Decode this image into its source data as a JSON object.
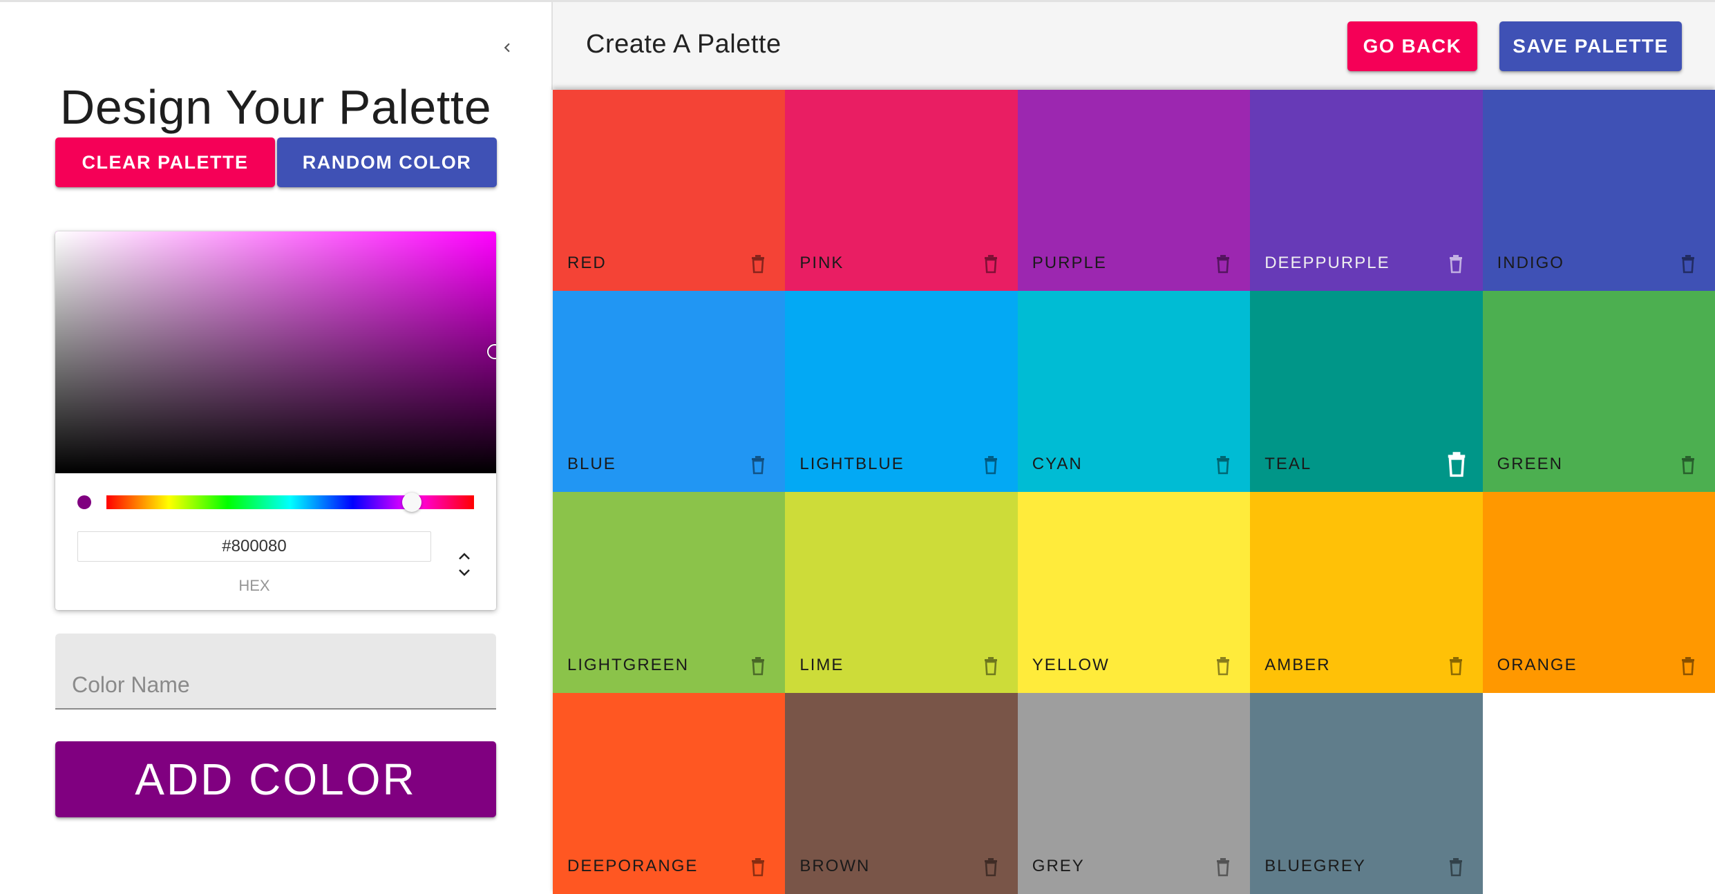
{
  "sidebar": {
    "title": "Design Your Palette",
    "clear_label": "Clear Palette",
    "random_label": "Random Color",
    "picker": {
      "current_color": "#800080",
      "hex_value": "#800080",
      "hex_label": "HEX",
      "hue_fraction": 0.83
    },
    "name_placeholder": "Color Name",
    "add_label": "Add Color"
  },
  "appbar": {
    "title": "Create A Palette",
    "back_label": "Go Back",
    "save_label": "Save Palette"
  },
  "colors": [
    {
      "name": "red",
      "hex": "#f44336",
      "text": "dark"
    },
    {
      "name": "pink",
      "hex": "#e91e63",
      "text": "dark"
    },
    {
      "name": "purple",
      "hex": "#9c27b0",
      "text": "dark"
    },
    {
      "name": "deeppurple",
      "hex": "#673ab7",
      "text": "light"
    },
    {
      "name": "indigo",
      "hex": "#3f51b5",
      "text": "dark"
    },
    {
      "name": "blue",
      "hex": "#2196f3",
      "text": "dark"
    },
    {
      "name": "lightblue",
      "hex": "#03a9f4",
      "text": "dark"
    },
    {
      "name": "cyan",
      "hex": "#00bcd4",
      "text": "dark"
    },
    {
      "name": "teal",
      "hex": "#009688",
      "text": "dark",
      "hovered": true
    },
    {
      "name": "green",
      "hex": "#4caf50",
      "text": "dark"
    },
    {
      "name": "lightgreen",
      "hex": "#8bc34a",
      "text": "dark"
    },
    {
      "name": "lime",
      "hex": "#cddc39",
      "text": "dark"
    },
    {
      "name": "yellow",
      "hex": "#ffeb3b",
      "text": "dark"
    },
    {
      "name": "amber",
      "hex": "#ffc107",
      "text": "dark"
    },
    {
      "name": "orange",
      "hex": "#ff9800",
      "text": "dark"
    },
    {
      "name": "deeporange",
      "hex": "#ff5722",
      "text": "dark"
    },
    {
      "name": "brown",
      "hex": "#795548",
      "text": "dark"
    },
    {
      "name": "grey",
      "hex": "#9e9e9e",
      "text": "dark"
    },
    {
      "name": "bluegrey",
      "hex": "#607d8b",
      "text": "dark"
    }
  ],
  "theme": {
    "primary": "#3f51b5",
    "secondary": "#f50057"
  }
}
